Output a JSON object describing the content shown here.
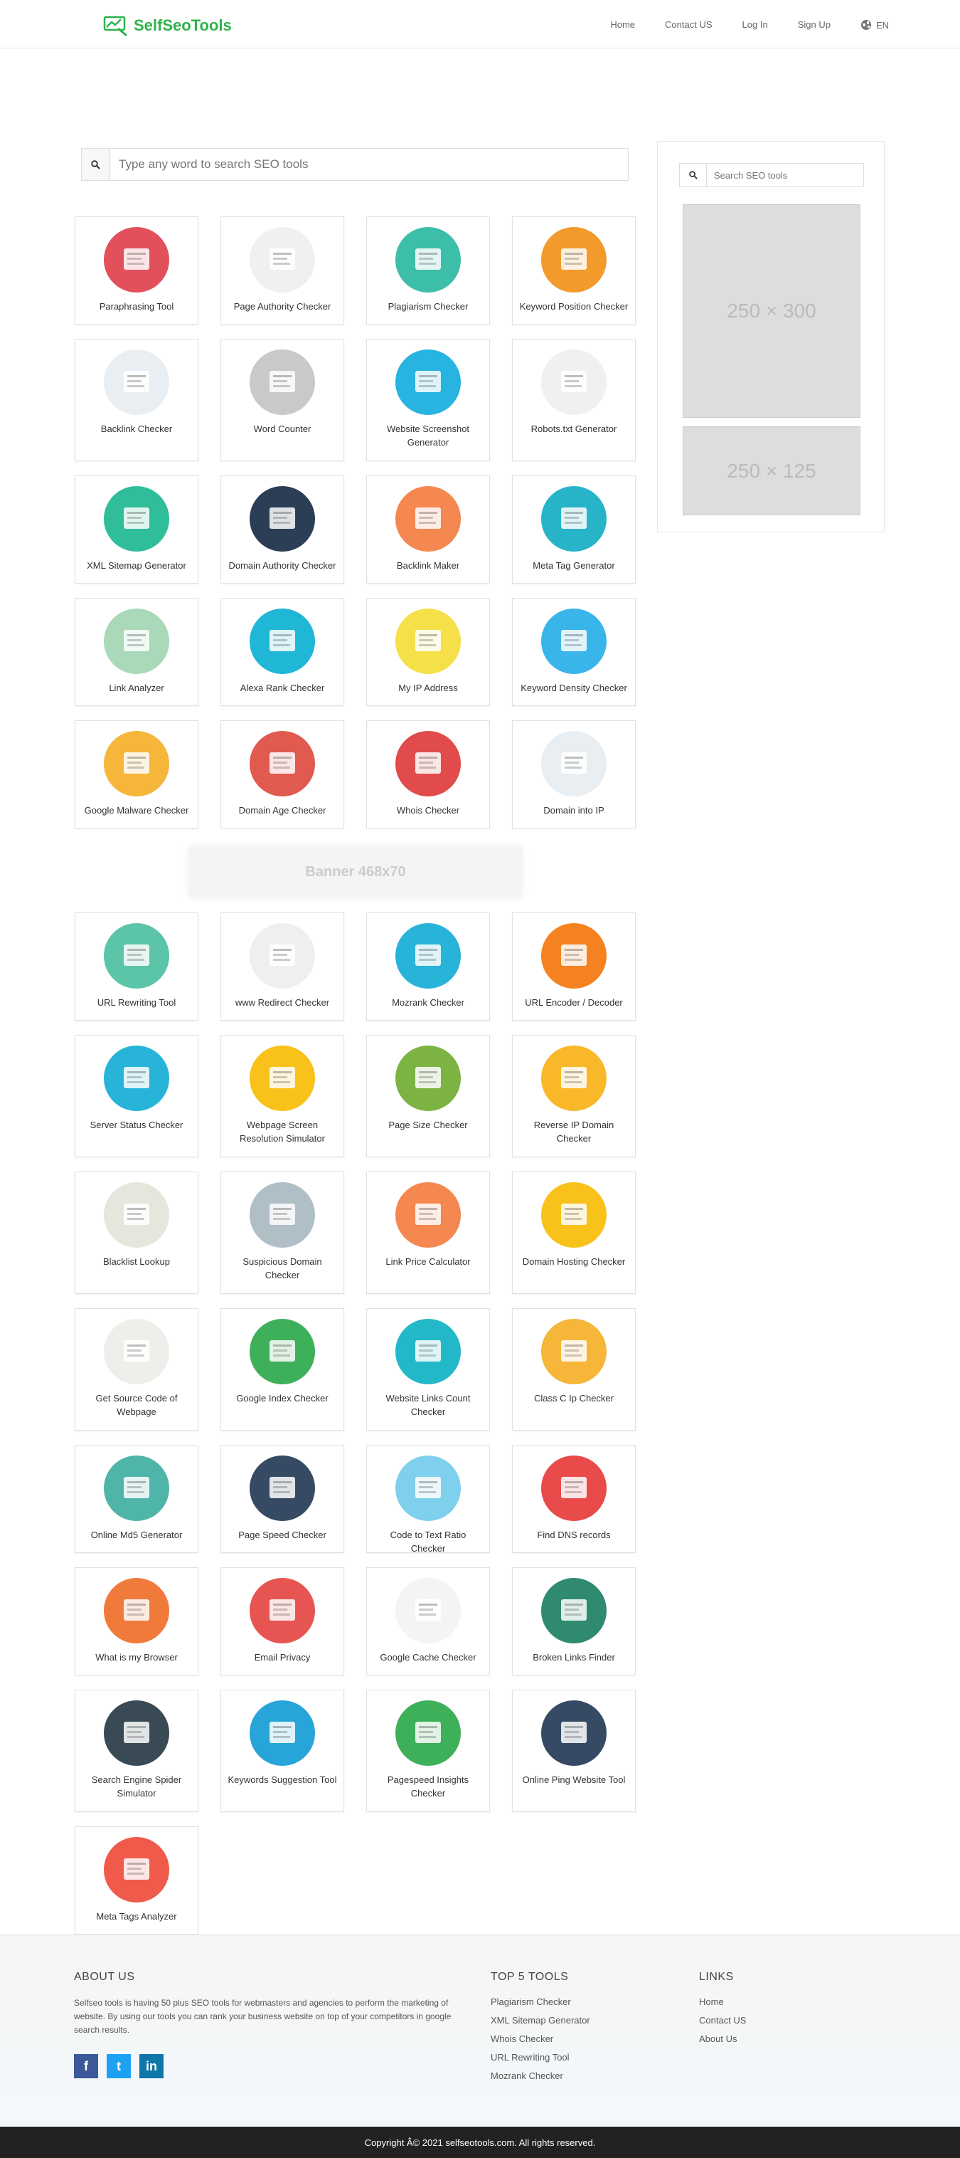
{
  "header": {
    "logo_text": "SelfSeoTools",
    "nav": [
      {
        "label": "Home"
      },
      {
        "label": "Contact US"
      },
      {
        "label": "Log In"
      },
      {
        "label": "Sign Up"
      }
    ],
    "lang": "EN"
  },
  "search": {
    "placeholder": "Type any word to search SEO tools"
  },
  "sidebar": {
    "search_placeholder": "Search SEO tools",
    "ad1": "250 × 300",
    "ad2": "250 × 125"
  },
  "banner": "Banner  468x70",
  "tools": [
    {
      "label": "Paraphrasing Tool",
      "color": "#e2505c",
      "icon": "checklist-icon"
    },
    {
      "label": "Page Authority Checker",
      "color": "#f2f0ee",
      "icon": "document-icon"
    },
    {
      "label": "Plagiarism Checker",
      "color": "#3dbea8",
      "icon": "magnifier-document-icon"
    },
    {
      "label": "Keyword Position Checker",
      "color": "#f39a2d",
      "icon": "line-graph-icon"
    },
    {
      "label": "Backlink Checker",
      "color": "#e9eef2",
      "icon": "chart-icon"
    },
    {
      "label": "Word Counter",
      "color": "#c9c9c9",
      "icon": "paper-icon"
    },
    {
      "label": "Website Screenshot Generator",
      "color": "#27b4e0",
      "icon": "browser-window-icon"
    },
    {
      "label": "Robots.txt Generator",
      "color": "#f0f0f0",
      "icon": "bug-icon"
    },
    {
      "label": "XML Sitemap Generator",
      "color": "#2fbd9a",
      "icon": "sitemap-icon"
    },
    {
      "label": "Domain Authority Checker",
      "color": "#2c3e55",
      "icon": "rocket-icon"
    },
    {
      "label": "Backlink Maker",
      "color": "#f58750",
      "icon": "bar-chart-icon"
    },
    {
      "label": "Meta Tag Generator",
      "color": "#28b4c8",
      "icon": "monitor-icon"
    },
    {
      "label": "Link Analyzer",
      "color": "#a9d9b9",
      "icon": "chain-link-icon"
    },
    {
      "label": "Alexa Rank Checker",
      "color": "#20b6d6",
      "icon": "letter-a-icon"
    },
    {
      "label": "My IP Address",
      "color": "#f5e04a",
      "icon": "map-pin-icon"
    },
    {
      "label": "Keyword Density Checker",
      "color": "#3ab5ea",
      "icon": "search-icon"
    },
    {
      "label": "Google Malware Checker",
      "color": "#f5b63a",
      "icon": "laptop-icon"
    },
    {
      "label": "Domain Age Checker",
      "color": "#e05a4f",
      "icon": "clock-icon"
    },
    {
      "label": "Whois Checker",
      "color": "#e14b4b",
      "icon": "padlock-icon"
    },
    {
      "label": "Domain into IP",
      "color": "#e9eef2",
      "icon": "globe-icon"
    },
    {
      "label": "URL Rewriting Tool",
      "color": "#5cc4a8",
      "icon": "url-bar-icon"
    },
    {
      "label": "www Redirect Checker",
      "color": "#efefef",
      "icon": "www-window-icon"
    },
    {
      "label": "Mozrank Checker",
      "color": "#27b4d8",
      "icon": "moz-icon"
    },
    {
      "label": "URL Encoder / Decoder",
      "color": "#f58220",
      "icon": "www-window-icon"
    },
    {
      "label": "Server Status Checker",
      "color": "#27b4d8",
      "icon": "server-icon"
    },
    {
      "label": "Webpage Screen Resolution Simulator",
      "color": "#f8c21a",
      "icon": "devices-icon"
    },
    {
      "label": "Page Size Checker",
      "color": "#7cb342",
      "icon": "download-icon"
    },
    {
      "label": "Reverse IP Domain Checker",
      "color": "#f8b82a",
      "icon": "laptop-ip-icon"
    },
    {
      "label": "Blacklist Lookup",
      "color": "#e6e6dc",
      "icon": "no-entry-icon"
    },
    {
      "label": "Suspicious Domain Checker",
      "color": "#b0bec5",
      "icon": "shield-icon"
    },
    {
      "label": "Link Price Calculator",
      "color": "#f58750",
      "icon": "money-hand-icon"
    },
    {
      "label": "Domain Hosting Checker",
      "color": "#f8c21a",
      "icon": "server-tower-icon"
    },
    {
      "label": "Get Source Code of Webpage",
      "color": "#f0eeea",
      "icon": "html-window-icon"
    },
    {
      "label": "Google Index Checker",
      "color": "#3fb05a",
      "icon": "google-search-icon"
    },
    {
      "label": "Website Links Count Checker",
      "color": "#22b8c8",
      "icon": "download-doc-icon"
    },
    {
      "label": "Class C Ip Checker",
      "color": "#f5b63a",
      "icon": "wrench-icon"
    },
    {
      "label": "Online Md5 Generator",
      "color": "#4fb5a8",
      "icon": "lock-icon"
    },
    {
      "label": "Page Speed Checker",
      "color": "#364b63",
      "icon": "rocket-icon"
    },
    {
      "label": "Code to Text Ratio Checker",
      "color": "#7fd0ec",
      "icon": "code-window-icon"
    },
    {
      "label": "Find DNS records",
      "color": "#e94b4b",
      "icon": "server-rack-icon"
    },
    {
      "label": "What is my Browser",
      "color": "#f07a3a",
      "icon": "browser-icon"
    },
    {
      "label": "Email Privacy",
      "color": "#e75553",
      "icon": "at-sign-icon"
    },
    {
      "label": "Google Cache Checker",
      "color": "#f4f4f4",
      "icon": "google-cache-icon"
    },
    {
      "label": "Broken Links Finder",
      "color": "#2f8a70",
      "icon": "search-404-icon"
    },
    {
      "label": "Search Engine Spider Simulator",
      "color": "#3a4a55",
      "icon": "robot-icon"
    },
    {
      "label": "Keywords Suggestion Tool",
      "color": "#27a5d8",
      "icon": "books-icon"
    },
    {
      "label": "Pagespeed Insights Checker",
      "color": "#3fb05a",
      "icon": "google-search-icon"
    },
    {
      "label": "Online Ping Website Tool",
      "color": "#364b63",
      "icon": "bar-chart-icon"
    },
    {
      "label": "Meta Tags Analyzer",
      "color": "#ef5a4a",
      "icon": "code-brackets-icon"
    }
  ],
  "footer": {
    "about_title": "ABOUT US",
    "about_text": "Selfseo tools is having 50 plus SEO tools for webmasters and agencies to perform the marketing of website. By using our tools you can rank your business website on top of your competitors in google search results.",
    "top_title": "TOP 5 TOOLS",
    "top_tools": [
      "Plagiarism Checker",
      "XML Sitemap Generator",
      "Whois Checker",
      "URL Rewriting Tool",
      "Mozrank Checker"
    ],
    "links_title": "LINKS",
    "links": [
      "Home",
      "Contact US",
      "About Us"
    ],
    "social": [
      {
        "label": "f",
        "color": "#3b5998",
        "icon": "facebook-icon"
      },
      {
        "label": "t",
        "color": "#1da1f2",
        "icon": "twitter-icon"
      },
      {
        "label": "in",
        "color": "#0e76a8",
        "icon": "linkedin-icon"
      }
    ],
    "copyright": "Copyright Â© 2021 selfseotools.com. All rights reserved."
  }
}
